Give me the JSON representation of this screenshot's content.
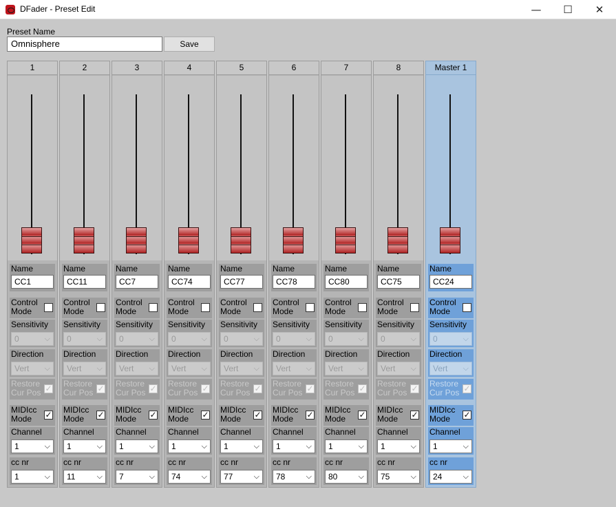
{
  "window": {
    "title": "DFader - Preset Edit",
    "min": "—",
    "max": "☐",
    "close": "✕"
  },
  "preset": {
    "label": "Preset Name",
    "value": "Omnisphere",
    "save_label": "Save"
  },
  "labels": {
    "name": "Name",
    "control_mode_1": "Control",
    "control_mode_2": "Mode",
    "sensitivity": "Sensitivity",
    "direction": "Direction",
    "restore_1": "Restore",
    "restore_2": "Cur Pos",
    "midicc_1": "MIDIcc",
    "midicc_2": "Mode",
    "channel": "Channel",
    "cc_nr": "cc nr"
  },
  "strips": [
    {
      "header": "1",
      "name": "CC1",
      "sensitivity": "0",
      "direction": "Vert",
      "channel": "1",
      "cc_nr": "1",
      "control_mode": false,
      "restore": true,
      "midicc": true
    },
    {
      "header": "2",
      "name": "CC11",
      "sensitivity": "0",
      "direction": "Vert",
      "channel": "1",
      "cc_nr": "11",
      "control_mode": false,
      "restore": true,
      "midicc": true
    },
    {
      "header": "3",
      "name": "CC7",
      "sensitivity": "0",
      "direction": "Vert",
      "channel": "1",
      "cc_nr": "7",
      "control_mode": false,
      "restore": true,
      "midicc": true
    },
    {
      "header": "4",
      "name": "CC74",
      "sensitivity": "0",
      "direction": "Vert",
      "channel": "1",
      "cc_nr": "74",
      "control_mode": false,
      "restore": true,
      "midicc": true
    },
    {
      "header": "5",
      "name": "CC77",
      "sensitivity": "0",
      "direction": "Vert",
      "channel": "1",
      "cc_nr": "77",
      "control_mode": false,
      "restore": true,
      "midicc": true
    },
    {
      "header": "6",
      "name": "CC78",
      "sensitivity": "0",
      "direction": "Vert",
      "channel": "1",
      "cc_nr": "78",
      "control_mode": false,
      "restore": true,
      "midicc": true
    },
    {
      "header": "7",
      "name": "CC80",
      "sensitivity": "0",
      "direction": "Vert",
      "channel": "1",
      "cc_nr": "80",
      "control_mode": false,
      "restore": true,
      "midicc": true
    },
    {
      "header": "8",
      "name": "CC75",
      "sensitivity": "0",
      "direction": "Vert",
      "channel": "1",
      "cc_nr": "75",
      "control_mode": false,
      "restore": true,
      "midicc": true
    },
    {
      "header": "Master 1",
      "name": "CC24",
      "sensitivity": "0",
      "direction": "Vert",
      "channel": "1",
      "cc_nr": "24",
      "control_mode": false,
      "restore": true,
      "midicc": true,
      "master": true
    }
  ],
  "icons": {
    "dropdown": "chevron-down-icon",
    "check": "check-icon"
  },
  "check_glyph": "✓",
  "arrow_glyph": "⌵"
}
